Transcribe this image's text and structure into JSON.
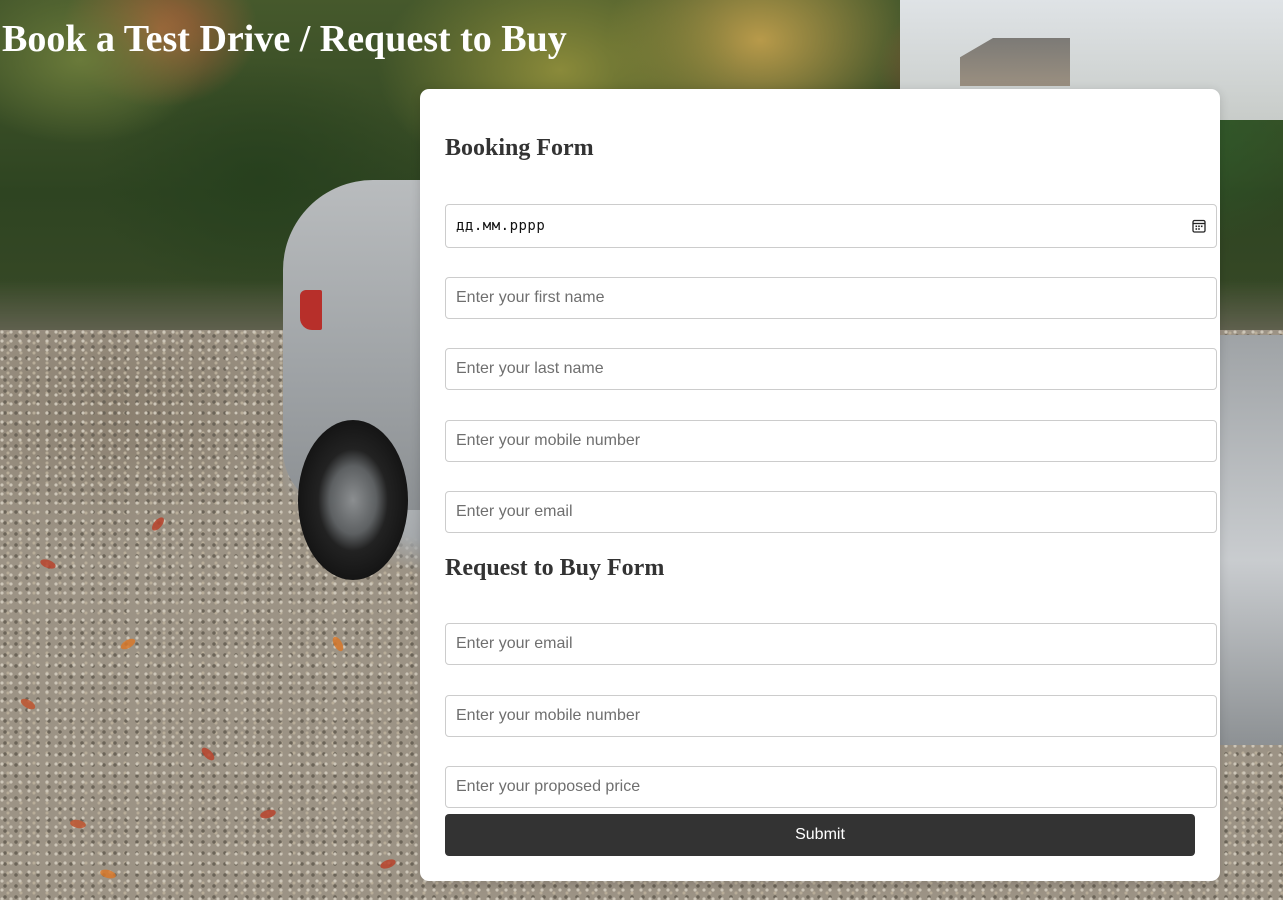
{
  "page": {
    "title": "Book a Test Drive / Request to Buy"
  },
  "booking_form": {
    "heading": "Booking Form",
    "date_value": "дд.мм.рррр",
    "first_name_placeholder": "Enter your first name",
    "last_name_placeholder": "Enter your last name",
    "mobile_placeholder": "Enter your mobile number",
    "email_placeholder": "Enter your email"
  },
  "buy_form": {
    "heading": "Request to Buy Form",
    "email_placeholder": "Enter your email",
    "mobile_placeholder": "Enter your mobile number",
    "price_placeholder": "Enter your proposed price",
    "submit_label": "Submit"
  },
  "colors": {
    "panel_bg": "#ffffff",
    "heading_text": "#333333",
    "submit_bg": "#333333",
    "submit_text": "#ffffff",
    "field_border": "#cccccc"
  },
  "icons": {
    "date_picker": "calendar-icon"
  }
}
